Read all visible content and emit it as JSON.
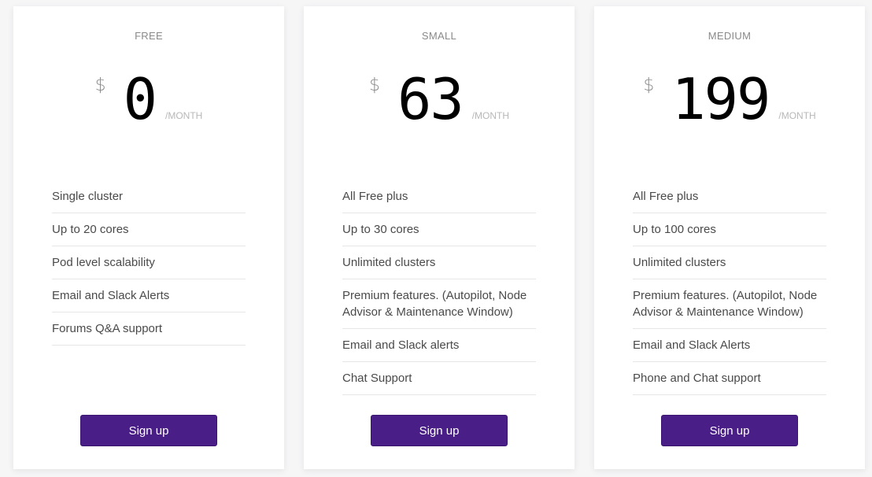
{
  "plans": [
    {
      "name": "FREE",
      "currency": "$",
      "amount": "0",
      "period": "/MONTH",
      "features": [
        "Single cluster",
        "Up to 20 cores",
        "Pod level scalability",
        "Email and Slack Alerts",
        "Forums Q&A support"
      ],
      "cta": "Sign up"
    },
    {
      "name": "SMALL",
      "currency": "$",
      "amount": "63",
      "period": "/MONTH",
      "features": [
        "All Free plus",
        "Up to 30 cores",
        "Unlimited clusters",
        "Premium features. (Autopilot, Node Advisor & Maintenance Window)",
        "Email and Slack alerts",
        "Chat Support"
      ],
      "cta": "Sign up"
    },
    {
      "name": "MEDIUM",
      "currency": "$",
      "amount": "199",
      "period": "/MONTH",
      "features": [
        "All Free plus",
        "Up to 100 cores",
        "Unlimited clusters",
        "Premium features. (Autopilot, Node Advisor & Maintenance Window)",
        "Email and Slack Alerts",
        "Phone and Chat support"
      ],
      "cta": "Sign up"
    }
  ],
  "colors": {
    "button": "#4a1e87",
    "background": "#f6f6f7"
  }
}
